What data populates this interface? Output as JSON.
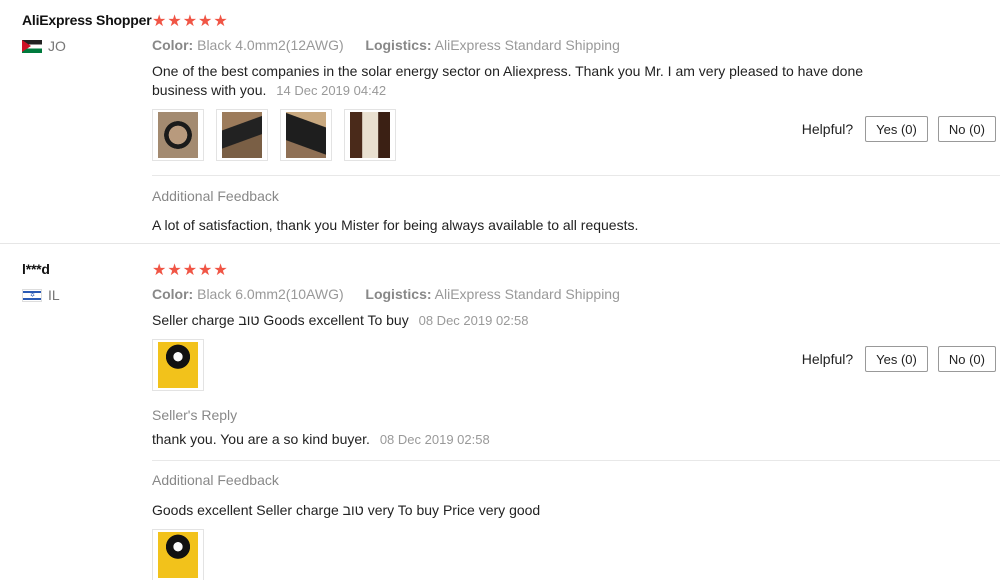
{
  "reviews": [
    {
      "user": "AliExpress Shopper",
      "country_code": "JO",
      "stars": "★★★★★",
      "color_key": "Color:",
      "color_value": "Black 4.0mm2(12AWG)",
      "logistics_key": "Logistics:",
      "logistics_value": "AliExpress Standard Shipping",
      "text_line1": "One of the best companies in the solar energy sector on Aliexpress. Thank you Mr. I am very pleased to have done",
      "text_line2": "business with you.",
      "date": "14 Dec 2019 04:42",
      "thumbnails": [
        "cable-coil-photo",
        "cable-closeup-photo",
        "cable-bundle-photo",
        "cable-label-photo"
      ],
      "helpful_label": "Helpful?",
      "yes_label": "Yes (0)",
      "no_label": "No (0)",
      "additional_title": "Additional Feedback",
      "additional_text": "A lot of satisfaction, thank you Mister for being always available to all requests."
    },
    {
      "user": "l***d",
      "country_code": "IL",
      "stars": "★★★★★",
      "color_key": "Color:",
      "color_value": "Black 6.0mm2(10AWG)",
      "logistics_key": "Logistics:",
      "logistics_value": "AliExpress Standard Shipping",
      "text": "Seller charge טוב Goods excellent To buy",
      "date": "08 Dec 2019 02:58",
      "thumbnails": [
        "yellow-cable-photo"
      ],
      "helpful_label": "Helpful?",
      "yes_label": "Yes (0)",
      "no_label": "No (0)",
      "reply_title": "Seller's Reply",
      "reply_text": "thank you. You are a so kind buyer.",
      "reply_date": "08 Dec 2019 02:58",
      "additional_title": "Additional Feedback",
      "additional_text": "Goods excellent Seller charge טוב very To buy Price very good",
      "additional_thumbnails": [
        "yellow-cable-photo"
      ]
    }
  ],
  "colors": {
    "star": "#f05545",
    "muted_text": "#999999",
    "divider": "#e8e8e8"
  }
}
